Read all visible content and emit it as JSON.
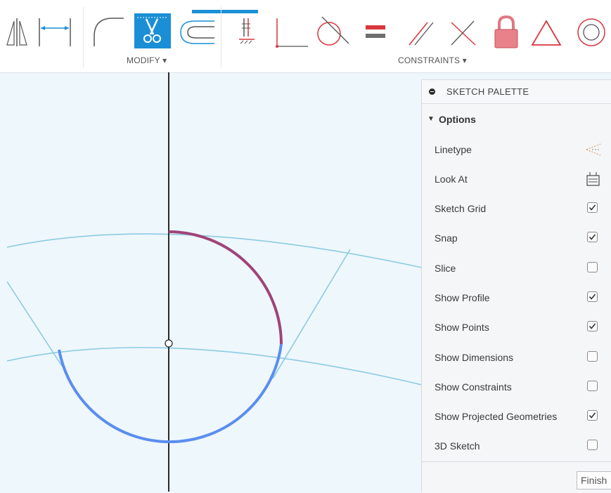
{
  "toolbar": {
    "modify_label": "MODIFY ▾",
    "constraints_label": "CONSTRAINTS ▾",
    "icons": [
      "mirror-icon",
      "dimension-icon",
      "fillet-icon",
      "trim-icon",
      "offset-icon",
      "fix-icon",
      "coincident-icon",
      "tangent-icon",
      "equal-icon",
      "parallel-icon",
      "perpendicular-icon",
      "lock-icon",
      "triangle-icon",
      "concentric-icon"
    ]
  },
  "palette": {
    "title": "SKETCH PALETTE",
    "options_label": "Options",
    "options": [
      {
        "label": "Linetype",
        "kind": "icon",
        "icon": "linetype-icon"
      },
      {
        "label": "Look At",
        "kind": "icon",
        "icon": "look-at-icon"
      },
      {
        "label": "Sketch Grid",
        "kind": "checkbox",
        "checked": true
      },
      {
        "label": "Snap",
        "kind": "checkbox",
        "checked": true
      },
      {
        "label": "Slice",
        "kind": "checkbox",
        "checked": false
      },
      {
        "label": "Show Profile",
        "kind": "checkbox",
        "checked": true
      },
      {
        "label": "Show Points",
        "kind": "checkbox",
        "checked": true
      },
      {
        "label": "Show Dimensions",
        "kind": "checkbox",
        "checked": false
      },
      {
        "label": "Show Constraints",
        "kind": "checkbox",
        "checked": false
      },
      {
        "label": "Show Projected Geometries",
        "kind": "checkbox",
        "checked": true
      },
      {
        "label": "3D Sketch",
        "kind": "checkbox",
        "checked": false
      }
    ],
    "finish_label": "Finish"
  },
  "colors": {
    "accent": "#1a8fd6",
    "constraint_red": "#d9363e",
    "sketch_blue": "#8ccbe3",
    "arc_purple": "#a0437a",
    "arc_blue": "#5a8df0"
  }
}
